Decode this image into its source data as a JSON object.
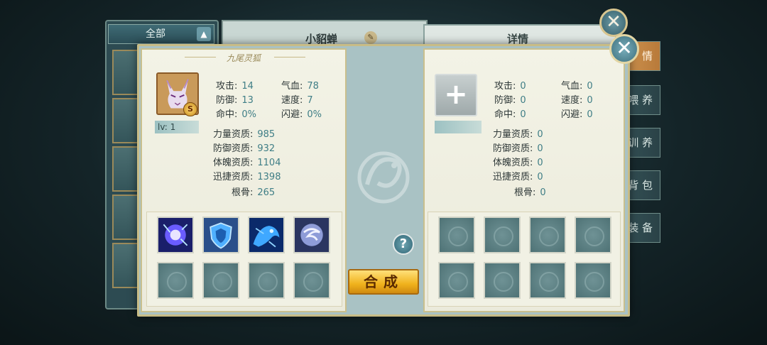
{
  "background": {
    "filter_tab": "全部",
    "pet_name": "小貂蝉",
    "detail_title": "详情",
    "side_tabs": [
      "情",
      "喂 养",
      "训 养",
      "背 包",
      "装 备"
    ]
  },
  "dialog": {
    "left_panel": {
      "title": "九尾灵狐",
      "grade": "S",
      "level": "lv: 1",
      "stats": [
        {
          "label": "攻击:",
          "value": "14"
        },
        {
          "label": "气血:",
          "value": "78"
        },
        {
          "label": "防御:",
          "value": "13"
        },
        {
          "label": "速度:",
          "value": "7"
        },
        {
          "label": "命中:",
          "value": "0%"
        },
        {
          "label": "闪避:",
          "value": "0%"
        }
      ],
      "aptitudes": [
        {
          "label": "力量资质:",
          "value": "985"
        },
        {
          "label": "防御资质:",
          "value": "932"
        },
        {
          "label": "体魄资质:",
          "value": "1104"
        },
        {
          "label": "迅捷资质:",
          "value": "1398"
        },
        {
          "label": "根骨:",
          "value": "265"
        }
      ]
    },
    "right_panel": {
      "add_icon": "+",
      "stats": [
        {
          "label": "攻击:",
          "value": "0"
        },
        {
          "label": "气血:",
          "value": "0"
        },
        {
          "label": "防御:",
          "value": "0"
        },
        {
          "label": "速度:",
          "value": "0"
        },
        {
          "label": "命中:",
          "value": "0"
        },
        {
          "label": "闪避:",
          "value": "0"
        }
      ],
      "aptitudes": [
        {
          "label": "力量资质:",
          "value": "0"
        },
        {
          "label": "防御资质:",
          "value": "0"
        },
        {
          "label": "体魄资质:",
          "value": "0"
        },
        {
          "label": "迅捷资质:",
          "value": "0"
        },
        {
          "label": "根骨:",
          "value": "0"
        }
      ]
    },
    "help_icon": "?",
    "combine_button": "合成",
    "close_icon": "✕"
  }
}
